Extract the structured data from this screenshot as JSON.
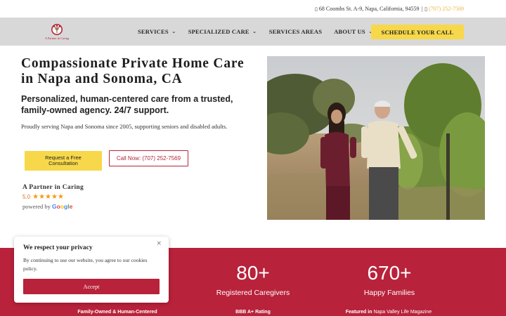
{
  "topbar": {
    "address": "68 Coombs St. A-9, Napa, California, 94559",
    "separator": "|",
    "phone": "(707) 252-7569",
    "location_icon": "map-pin-icon",
    "phone_icon": "phone-icon"
  },
  "header": {
    "logo_text": "A Partner in Caring",
    "nav": [
      {
        "label": "SERVICES",
        "dropdown": true
      },
      {
        "label": "SPECIALIZED CARE",
        "dropdown": true
      },
      {
        "label": "SERVICES AREAS",
        "dropdown": false
      },
      {
        "label": "ABOUT US",
        "dropdown": true
      }
    ],
    "cta": "SCHEDULE YOUR CALL",
    "chevron": "⌄"
  },
  "hero": {
    "title": "Compassionate Private Home Care in Napa and Sonoma, CA",
    "subtitle": "Personalized, human-centered care from a trusted, family-owned agency. 24/7 support.",
    "description": "Proudly serving Napa and Sonoma since 2005, supporting seniors and disabled adults.",
    "btn_free": "Request a Free Consultation",
    "btn_call": "Call Now: (707) 252-7569"
  },
  "review": {
    "name": "A Partner in Caring",
    "rating": "5.0",
    "stars": "★★★★★",
    "powered_by": "powered by",
    "google": "Google"
  },
  "stats": [
    {
      "number": "80+",
      "label": "Registered Caregivers"
    },
    {
      "number": "670+",
      "label": "Happy Families"
    }
  ],
  "badges": [
    {
      "label": "Family-Owned & Human-Centered"
    },
    {
      "label": "BBB A+ Rating"
    },
    {
      "label_prefix": "Featured in",
      "label_highlight": "Napa Valley Life Magazine"
    }
  ],
  "cookie": {
    "title": "We respect your privacy",
    "text": "By continuing to use our website, you agree to our cookies policy.",
    "accept": "Accept",
    "close": "×"
  },
  "colors": {
    "accent_yellow": "#f7d84a",
    "brand_red": "#b8223a",
    "phone_gold": "#e9b545",
    "nav_gray": "#d8d8d8"
  }
}
